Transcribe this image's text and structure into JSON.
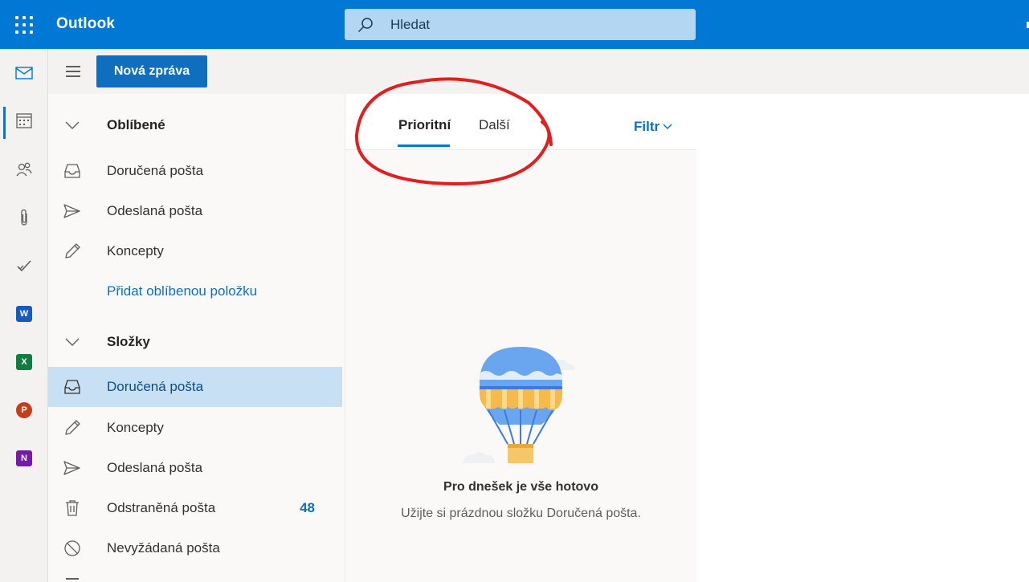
{
  "header": {
    "app_name": "Outlook",
    "search_placeholder": "Hledat"
  },
  "command_bar": {
    "new_message_label": "Nová zpráva"
  },
  "app_rail": {
    "items": [
      "mail-icon",
      "calendar-icon",
      "people-icon",
      "files-icon",
      "todo-icon",
      "word-icon",
      "excel-icon",
      "powerpoint-icon",
      "onenote-icon"
    ],
    "app_letters": {
      "word": "W",
      "excel": "X",
      "powerpoint": "P",
      "onenote": "N"
    }
  },
  "folder_pane": {
    "favorites_header": "Oblíbené",
    "favorites": [
      {
        "label": "Doručená pošta",
        "icon": "inbox-icon"
      },
      {
        "label": "Odeslaná pošta",
        "icon": "send-icon"
      },
      {
        "label": "Koncepty",
        "icon": "draft-icon"
      }
    ],
    "add_favorite_link": "Přidat oblíbenou položku",
    "folders_header": "Složky",
    "folders": [
      {
        "label": "Doručená pošta",
        "icon": "inbox-icon",
        "selected": true
      },
      {
        "label": "Koncepty",
        "icon": "draft-icon"
      },
      {
        "label": "Odeslaná pošta",
        "icon": "send-icon"
      },
      {
        "label": "Odstraněná pošta",
        "icon": "trash-icon",
        "count": "48"
      },
      {
        "label": "Nevyžádaná pošta",
        "icon": "junk-icon"
      }
    ]
  },
  "message_list": {
    "tabs": [
      {
        "label": "Prioritní",
        "selected": true
      },
      {
        "label": "Další",
        "selected": false
      }
    ],
    "filter_label": "Filtr",
    "empty_state": {
      "title": "Pro dnešek je vše hotovo",
      "subtitle": "Užijte si prázdnou složku Doručená pošta."
    }
  },
  "colors": {
    "brand_blue": "#0078d4",
    "button_blue": "#106ebe",
    "selected_folder_bg": "#c7e0f4",
    "annotation_red": "#e02020"
  }
}
